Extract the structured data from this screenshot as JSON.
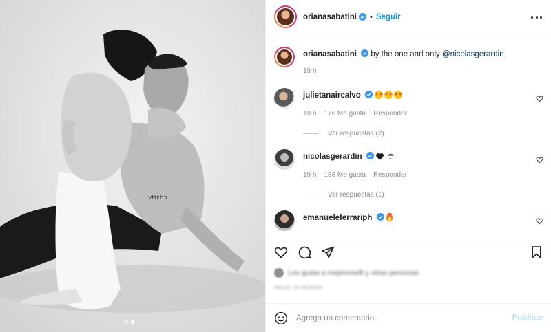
{
  "post": {
    "author": "orianasabatini",
    "follow_label": "Seguir",
    "dot": "•",
    "caption_user": "orianasabatini",
    "caption_text": "by the one and only",
    "caption_mention": "@nicolasgerardin",
    "caption_time": "19 h",
    "photo_alt": "Black and white photo of couple embracing",
    "carousel_count": 2,
    "carousel_active": 1
  },
  "comments": [
    {
      "user": "julietanaircalvo",
      "emojis": [
        "star-struck",
        "star-struck",
        "star-struck"
      ],
      "time": "19 h",
      "likes": "176 Me gusta",
      "reply": "Responder",
      "view_replies": "Ver respuestas (2)"
    },
    {
      "user": "nicolasgerardin",
      "emojis": [
        "black-heart",
        "umbrella"
      ],
      "time": "19 h",
      "likes": "188 Me gusta",
      "reply": "Responder",
      "view_replies": "Ver respuestas (1)"
    },
    {
      "user": "emanueleferrariph",
      "emojis": [
        "fire"
      ]
    }
  ],
  "likes_line": "Les gusta a mejimonelli y otras personas",
  "posted_date": "HACE 19 HORAS",
  "composer": {
    "placeholder": "Agrega un comentario...",
    "publish_label": "Publicar"
  },
  "colors": {
    "accent": "#0095f6",
    "publish_disabled": "#b2dffc",
    "verified": "#3897f0",
    "mention": "#00376b",
    "muted": "#8e8e8e"
  },
  "icons": [
    "verified-icon",
    "more-options-icon",
    "heart-icon",
    "comment-icon",
    "share-icon",
    "bookmark-icon",
    "emoji-icon"
  ]
}
